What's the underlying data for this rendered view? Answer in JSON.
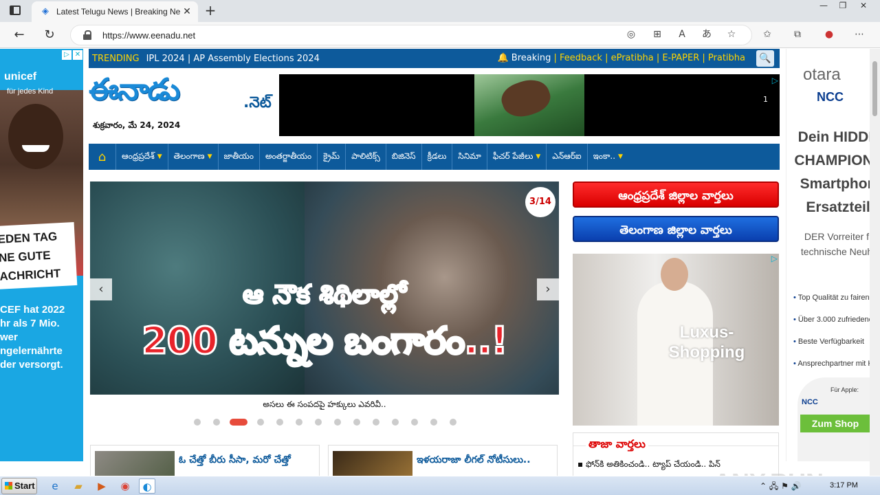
{
  "browser": {
    "tab_title": "Latest Telugu News | Breaking Ne",
    "url": "https://www.eenadu.net",
    "new_tab_symbol": "+",
    "close_symbol": "✕"
  },
  "topbar": {
    "trending_label": "TRENDING",
    "trending_items": "IPL 2024  |  AP Assembly Elections 2024",
    "links": [
      "Breaking",
      "Feedback",
      "ePratibha",
      "E-PAPER",
      "Pratibha"
    ]
  },
  "logo": {
    "name": "ఈనాడు",
    "suffix": ".నెట్",
    "date": "శుక్రవారం, మే 24, 2024"
  },
  "top_ad": {
    "page": "1"
  },
  "nav": {
    "items": [
      {
        "label": "ఆంధ్రప్రదేశ్",
        "dropdown": true
      },
      {
        "label": "తెలంగాణ",
        "dropdown": true
      },
      {
        "label": "జాతీయం",
        "dropdown": false
      },
      {
        "label": "అంతర్జాతీయం",
        "dropdown": false
      },
      {
        "label": "క్రైమ్",
        "dropdown": false
      },
      {
        "label": "పాలిటిక్స్",
        "dropdown": false
      },
      {
        "label": "బిజినెస్",
        "dropdown": false
      },
      {
        "label": "క్రీడలు",
        "dropdown": false
      },
      {
        "label": "సినిమా",
        "dropdown": false
      },
      {
        "label": "ఫీచర్ పేజీలు",
        "dropdown": true
      },
      {
        "label": "ఎన్‌ఆర్ఐ",
        "dropdown": false
      },
      {
        "label": "ఇంకా..",
        "dropdown": true
      }
    ]
  },
  "slider": {
    "counter": "3/14",
    "headline_line1": "ఆ నౌక శిథిలాల్లో",
    "headline_line2": "200 టన్నుల బంగారం..!",
    "caption": "అసలు ఈ సంపదపై హక్కులు ఎవరివీ..",
    "dot_count": 14,
    "active_dot": 2
  },
  "district_buttons": {
    "ap": "ఆంధ్రప్రదేశ్ జిల్లాల వార్తలు",
    "tg": "తెలంగాణ జిల్లాల వార్తలు"
  },
  "side_ad": {
    "text": "Luxus-Shopping"
  },
  "taja": {
    "header": "తాజా వార్తలు",
    "first_item": "▪ ఫోన్‌కి అతికించండి.. ట్యాప్ చేయండి.. పిన్"
  },
  "news_cards": [
    {
      "headline": "ఓ చేత్తో బీరు సీసా, మరో చేత్తో"
    },
    {
      "headline": "ఇళయరాజా లీగల్ నోటీసులు.."
    }
  ],
  "left_ad": {
    "brand": "unicef",
    "brand_sub": "für jedes Kind",
    "card_lines": [
      "EDEN TAG",
      "NE GUTE",
      "ACHRICHT"
    ],
    "body_lines": [
      "CEF hat 2022",
      "hr als 7 Mio.",
      "wer",
      "ngelernährte",
      "der versorgt."
    ]
  },
  "right_ad": {
    "brand": "otara",
    "partner": "NCC",
    "headline_lines": [
      "Dein HIDDE",
      "CHAMPION f",
      "Smartphon",
      "Ersatzteil"
    ],
    "sub_lines": [
      "DER Vorreiter f",
      "technische Neuh"
    ],
    "bullets": [
      "Top Qualität zu fairen P",
      "Über 3.000 zufriedene K",
      "Beste Verfügbarkeit",
      "Ansprechpartner mit Kr"
    ],
    "apple_label": "Für Apple:",
    "cta": "Zum Shop"
  },
  "watermark": "ANY.RUN",
  "taskbar": {
    "start_label": "Start",
    "clock": "3:17 PM"
  }
}
